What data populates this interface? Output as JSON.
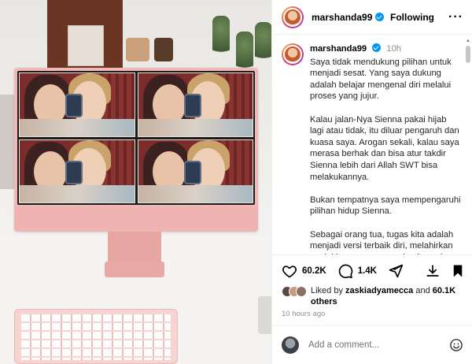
{
  "post": {
    "username": "marshanda99",
    "follow_state": "Following",
    "more_label": "···",
    "time": "10h",
    "caption_paragraphs": [
      "Saya tidak mendukung pilihan untuk menjadi sesat. Yang saya dukung adalah belajar mengenal diri melalui proses yang jujur.",
      "Kalau jalan-Nya Sienna pakai hijab lagi atau tidak, itu diluar pengaruh dan kuasa saya. Arogan sekali, kalau saya merasa berhak dan bisa atur takdir Sienna lebih dari Allah SWT bisa melakukannya.",
      "Bukan tempatnya saya mempengaruhi pilihan hidup Sienna.",
      "Sebagai orang tua, tugas kita adalah menjadi versi terbaik diri, melahirkan anak kita yang secara alaminya akan"
    ]
  },
  "actions": {
    "likes_count": "60.2K",
    "comments_count": "1.4K",
    "icons": [
      "heart-icon",
      "comment-icon",
      "share-icon",
      "download-icon",
      "bookmark-icon"
    ]
  },
  "likes": {
    "prefix": "Liked by",
    "user": "zaskiadyamecca",
    "and": "and",
    "others": "60.1K others"
  },
  "time_ago": "10 hours ago",
  "comment": {
    "placeholder": "Add a comment..."
  },
  "colors": {
    "verified": "#0095f6",
    "muted": "#8e8e8e"
  }
}
